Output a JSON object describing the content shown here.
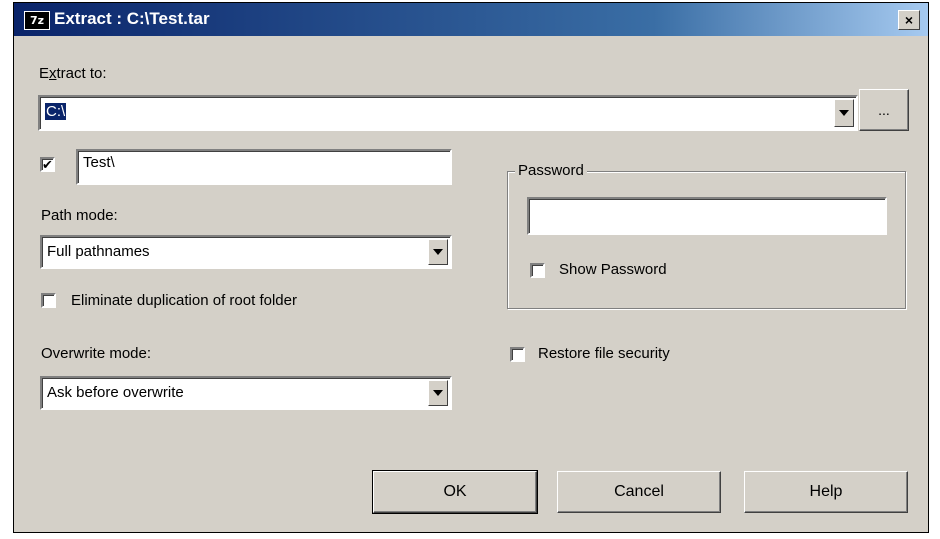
{
  "window": {
    "title": "Extract : C:\\Test.tar",
    "icon_label": "7z",
    "close_glyph": "×"
  },
  "extract_to": {
    "label_prefix": "E",
    "label_mnemonic": "x",
    "label_suffix": "tract to:",
    "value": "C:\\",
    "browse_label": "..."
  },
  "subfolder": {
    "checked": true,
    "check_glyph": "✔",
    "value": "Test\\"
  },
  "path_mode": {
    "label": "Path mode:",
    "selected": "Full pathnames"
  },
  "eliminate_duplication": {
    "checked": false,
    "label": "Eliminate duplication of root folder"
  },
  "overwrite_mode": {
    "label": "Overwrite mode:",
    "selected": "Ask before overwrite"
  },
  "password": {
    "group_label": "Password",
    "value": "",
    "show_password": {
      "checked": false,
      "label": "Show Password"
    }
  },
  "restore_security": {
    "checked": false,
    "label": "Restore file security"
  },
  "buttons": {
    "ok": "OK",
    "cancel": "Cancel",
    "help": "Help"
  }
}
